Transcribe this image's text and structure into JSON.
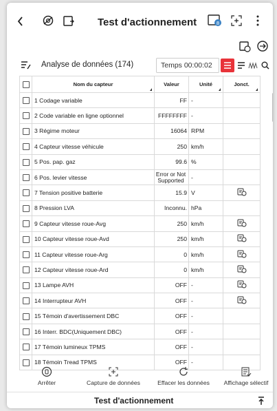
{
  "header": {
    "title": "Test d'actionnement"
  },
  "toolbar": {
    "analyse_label": "Analyse de données (174)",
    "time_label": "Temps 00:00:02"
  },
  "table": {
    "headers": [
      "Nom du capteur",
      "Valeur",
      "Unité",
      "Jonct."
    ],
    "rows": [
      {
        "name": "1 Codage variable",
        "value": "FF",
        "unit": "-",
        "jonct": false
      },
      {
        "name": "2 Code variable en ligne optionnel",
        "value": "FFFFFFFF",
        "unit": "-",
        "jonct": false
      },
      {
        "name": "3 Régime moteur",
        "value": "16064",
        "unit": "RPM",
        "jonct": false
      },
      {
        "name": "4 Capteur vitesse véhicule",
        "value": "250",
        "unit": "km/h",
        "jonct": false
      },
      {
        "name": "5 Pos. pap. gaz",
        "value": "99.6",
        "unit": "%",
        "jonct": false
      },
      {
        "name": "6 Pos. levier vitesse",
        "value": "Error or Not Supported",
        "unit": "-",
        "jonct": false
      },
      {
        "name": "7 Tension positive batterie",
        "value": "15.9",
        "unit": "V",
        "jonct": true
      },
      {
        "name": "8 Pression LVA",
        "value": "Inconnu.",
        "unit": "hPa",
        "jonct": false
      },
      {
        "name": "9 Capteur vitesse roue-Avg",
        "value": "250",
        "unit": "km/h",
        "jonct": true
      },
      {
        "name": "10 Capteur vitesse roue-Avd",
        "value": "250",
        "unit": "km/h",
        "jonct": true
      },
      {
        "name": "11 Capteur vitesse roue-Arg",
        "value": "0",
        "unit": "km/h",
        "jonct": true
      },
      {
        "name": "12 Capteur vitesse roue-Ard",
        "value": "0",
        "unit": "km/h",
        "jonct": true
      },
      {
        "name": "13 Lampe AVH",
        "value": "OFF",
        "unit": "-",
        "jonct": true
      },
      {
        "name": "14 Interrupteur AVH",
        "value": "OFF",
        "unit": "-",
        "jonct": true
      },
      {
        "name": "15 Témoin d'avertissement DBC",
        "value": "OFF",
        "unit": "-",
        "jonct": false
      },
      {
        "name": "16 Interr. BDC(Uniquement DBC)",
        "value": "OFF",
        "unit": "-",
        "jonct": false
      },
      {
        "name": "17 Témoin lumineux TPMS",
        "value": "OFF",
        "unit": "-",
        "jonct": false
      },
      {
        "name": "18 Témoin Tread TPMS",
        "value": "OFF",
        "unit": "-",
        "jonct": false
      }
    ]
  },
  "bottom_bar": {
    "stop": "Arrêter",
    "capture": "Capture de données",
    "clear": "Effacer les données",
    "selective": "Affichage sélectif"
  },
  "footer": {
    "title": "Test d'actionnement"
  },
  "icons": {
    "back": "chevron-left-icon",
    "accent": "#e8333a"
  }
}
